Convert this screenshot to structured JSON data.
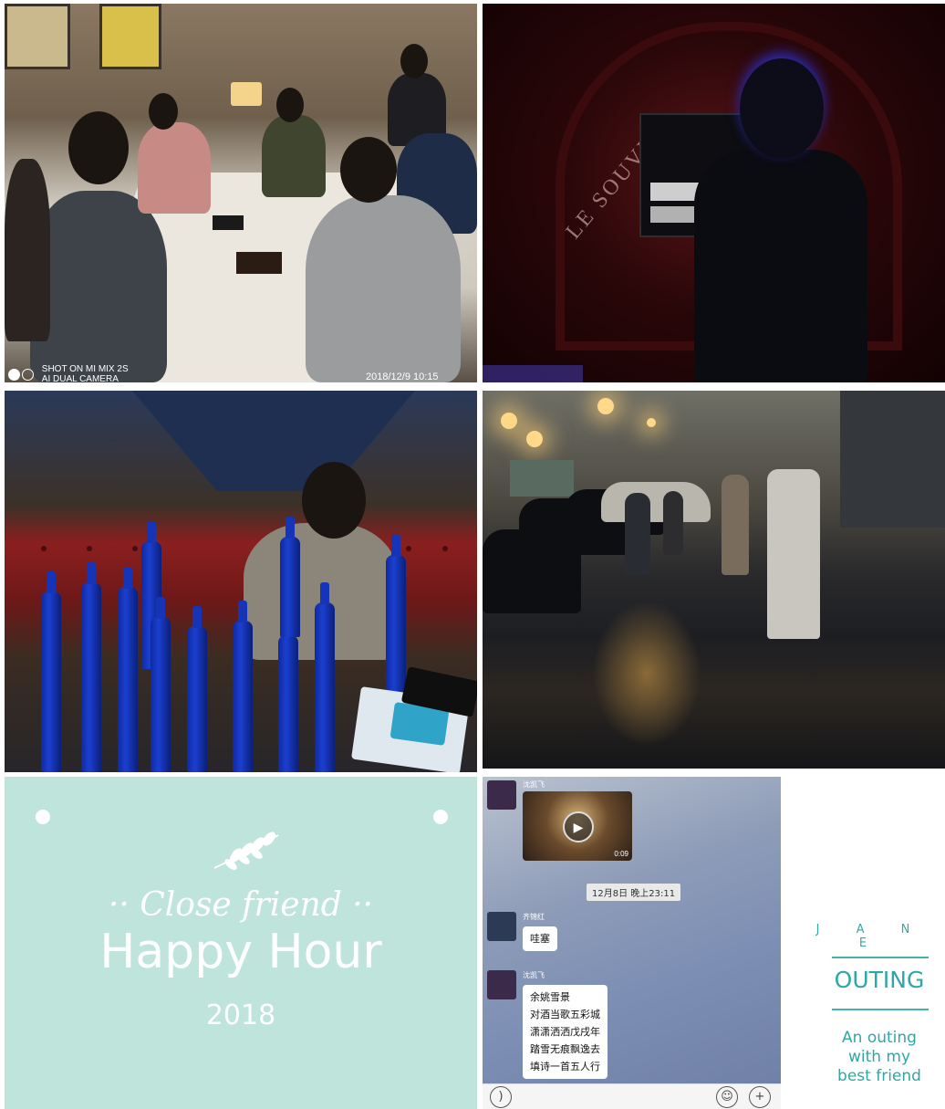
{
  "photo_game_room": {
    "camera_line1": "SHOT ON MI MIX 2S",
    "camera_line2": "AI DUAL CAMERA",
    "timestamp": "2018/12/9 10:15"
  },
  "photo_karaoke": {
    "wall_text": "LE SOUVE"
  },
  "photo_beer": {},
  "photo_snow_street": {},
  "happy_hour_card": {
    "subtitle": "·· Close friend ··",
    "title": "Happy Hour",
    "year": "2018",
    "background": "#bfe4dc"
  },
  "chat": {
    "user1": "沈凯飞",
    "video_duration": "0:09",
    "time_divider": "12月8日 晚上23:11",
    "user2": "齐锦红",
    "message1": "哇塞",
    "user3": "沈凯飞",
    "poem_lines": [
      "余姚雪景",
      "对酒当歌五彩城",
      "潇潇洒洒戊戌年",
      "踏雪无痕飘逸去",
      "填诗一首五人行"
    ]
  },
  "outing_card": {
    "name": "J A N E",
    "title": "OUTING",
    "subtitle_lines": [
      "An outing",
      "with my",
      "best friend"
    ],
    "accent": "#2fa7a6"
  }
}
